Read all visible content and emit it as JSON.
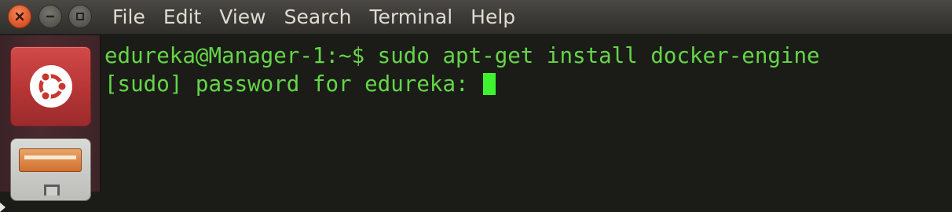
{
  "window": {
    "buttons": {
      "close": "close",
      "minimize": "minimize",
      "maximize": "maximize"
    }
  },
  "menubar": {
    "items": [
      {
        "label": "File"
      },
      {
        "label": "Edit"
      },
      {
        "label": "View"
      },
      {
        "label": "Search"
      },
      {
        "label": "Terminal"
      },
      {
        "label": "Help"
      }
    ]
  },
  "launcher": {
    "items": [
      {
        "icon": "ubuntu-logo-icon"
      },
      {
        "icon": "files-cabinet-icon"
      }
    ]
  },
  "terminal": {
    "lines": [
      "edureka@Manager-1:~$ sudo apt-get install docker-engine",
      "[sudo] password for edureka: "
    ],
    "colors": {
      "background": "#1b1c18",
      "text": "#65d548",
      "cursor": "#3ff22f"
    }
  }
}
